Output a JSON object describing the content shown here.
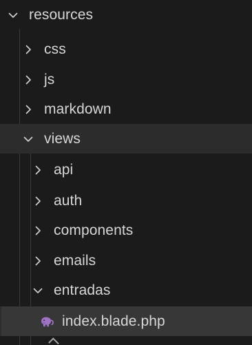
{
  "explorer": {
    "items": [
      {
        "label": "resources",
        "type": "folder",
        "expanded": true,
        "level": 0
      },
      {
        "label": "css",
        "type": "folder",
        "expanded": false,
        "level": 1
      },
      {
        "label": "js",
        "type": "folder",
        "expanded": false,
        "level": 1
      },
      {
        "label": "markdown",
        "type": "folder",
        "expanded": false,
        "level": 1
      },
      {
        "label": "views",
        "type": "folder",
        "expanded": true,
        "level": 1
      },
      {
        "label": "api",
        "type": "folder",
        "expanded": false,
        "level": 2
      },
      {
        "label": "auth",
        "type": "folder",
        "expanded": false,
        "level": 2
      },
      {
        "label": "components",
        "type": "folder",
        "expanded": false,
        "level": 2
      },
      {
        "label": "emails",
        "type": "folder",
        "expanded": false,
        "level": 2
      },
      {
        "label": "entradas",
        "type": "folder",
        "expanded": true,
        "level": 2
      },
      {
        "label": "index.blade.php",
        "type": "file",
        "icon": "php-elephant-icon",
        "level": 3,
        "selected": true
      }
    ]
  },
  "colors": {
    "background": "#1b1b1b",
    "selected_row": "#373737",
    "text": "#d7d7d7",
    "chevron": "#cfcfcf",
    "indent_guide": "#3a3a3a",
    "php_icon": "#a074c4"
  }
}
